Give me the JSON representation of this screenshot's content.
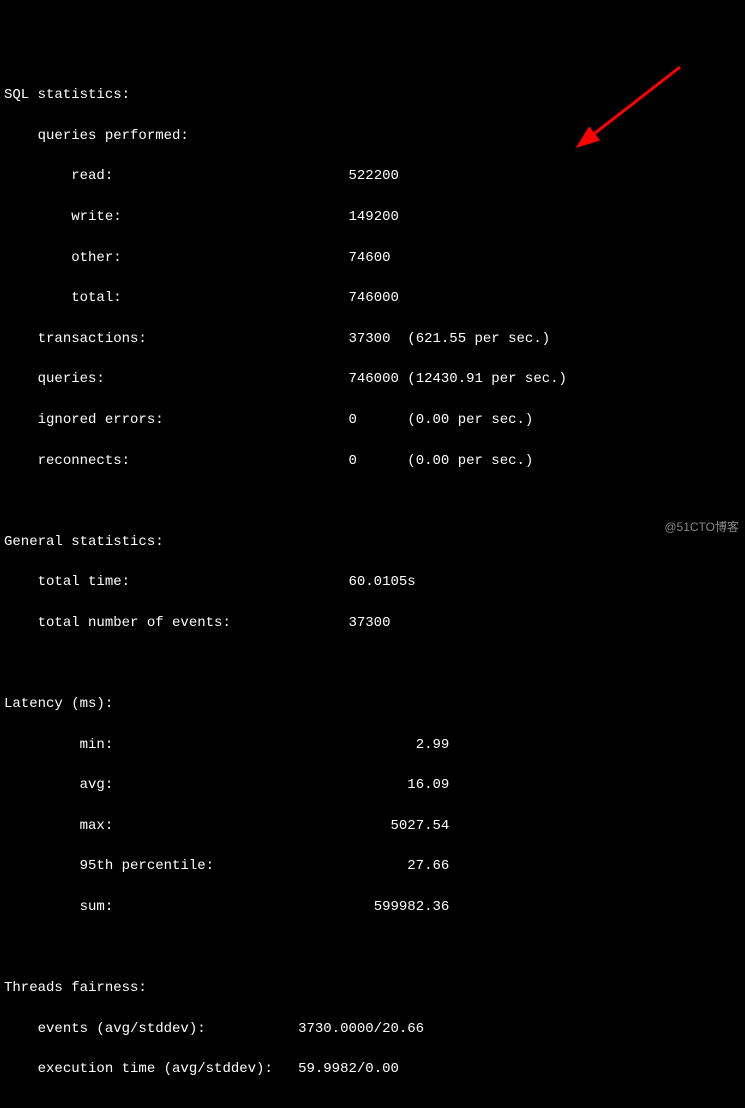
{
  "sections": {
    "sql": {
      "title": "SQL statistics:",
      "queries_performed_label": "queries performed:",
      "read_label": "read:",
      "read_value": "522200",
      "write_label": "write:",
      "write_value": "149200",
      "other_label": "other:",
      "other_value": "74600",
      "total_label": "total:",
      "total_value": "746000",
      "transactions_label": "transactions:",
      "transactions_value": "37300",
      "transactions_rate": "(621.55 per sec.)",
      "queries_label": "queries:",
      "queries_value": "746000",
      "queries_rate": "(12430.91 per sec.)",
      "ignored_errors_label": "ignored errors:",
      "ignored_errors_value": "0",
      "ignored_errors_rate": "(0.00 per sec.)",
      "reconnects_label": "reconnects:",
      "reconnects_value": "0",
      "reconnects_rate": "(0.00 per sec.)"
    },
    "general": {
      "title": "General statistics:",
      "total_time_label": "total time:",
      "total_time_value": "60.0105s",
      "total_events_label": "total number of events:",
      "total_events_value": "37300"
    },
    "latency": {
      "title": "Latency (ms):",
      "min_label": "min:",
      "min_value": "2.99",
      "avg_label": "avg:",
      "avg_value": "16.09",
      "max_label": "max:",
      "max_value": "5027.54",
      "p95_label": "95th percentile:",
      "p95_value": "27.66",
      "sum_label": "sum:",
      "sum_value": "599982.36"
    },
    "threads": {
      "title": "Threads fairness:",
      "events_label": "events (avg/stddev):",
      "events_value": "3730.0000/20.66",
      "exec_label": "execution time (avg/stddev):",
      "exec_value": "59.9982/0.00"
    }
  },
  "watermark": "@51CTO博客",
  "arrow_color": "#ff0000"
}
